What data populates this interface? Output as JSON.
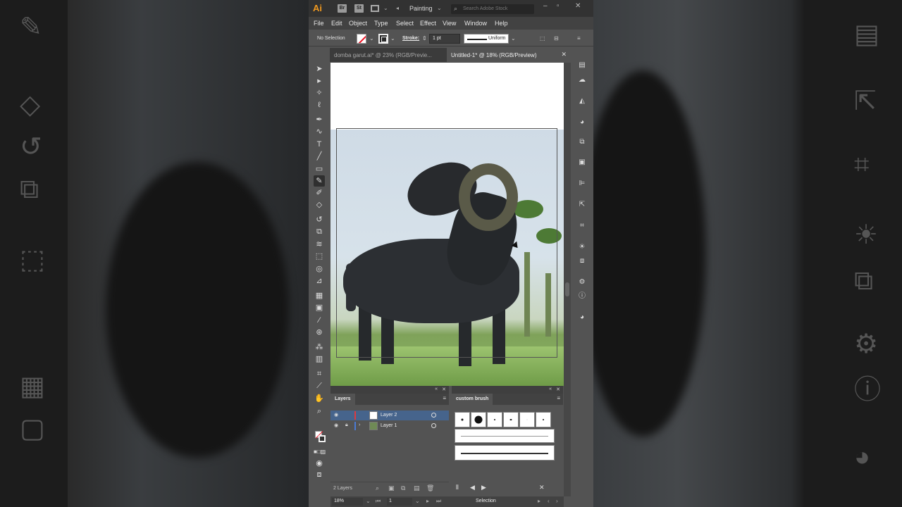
{
  "app": {
    "logo": "Ai",
    "bridge_chip": "Br",
    "stock_chip": "St",
    "workspace": "Painting",
    "search_placeholder": "Search Adobe Stock"
  },
  "menu": [
    "File",
    "Edit",
    "Object",
    "Type",
    "Select",
    "Effect",
    "View",
    "Window",
    "Help"
  ],
  "control_bar": {
    "selection_status": "No Selection",
    "stroke_label": "Stroke:",
    "stroke_weight": "1 pt",
    "profile": "Uniform"
  },
  "tabs": [
    {
      "label": "domba garut.ai* @ 23% (RGB/Previe...",
      "active": false
    },
    {
      "label": "Untitled-1* @ 18% (RGB/Preview)",
      "active": true
    }
  ],
  "layers_panel": {
    "title": "Layers",
    "layers": [
      {
        "name": "Layer 2",
        "color": "#e0393e",
        "selected": true
      },
      {
        "name": "Layer 1",
        "color": "#4a7bd4",
        "selected": false
      }
    ],
    "count": "2 Layers"
  },
  "brush_panel": {
    "title": "custom brush"
  },
  "status_bar": {
    "zoom": "18%",
    "page": "1",
    "mode": "Selection"
  },
  "colors": {
    "accent_orange": "#f29a1f",
    "selection_blue": "#46648c"
  }
}
